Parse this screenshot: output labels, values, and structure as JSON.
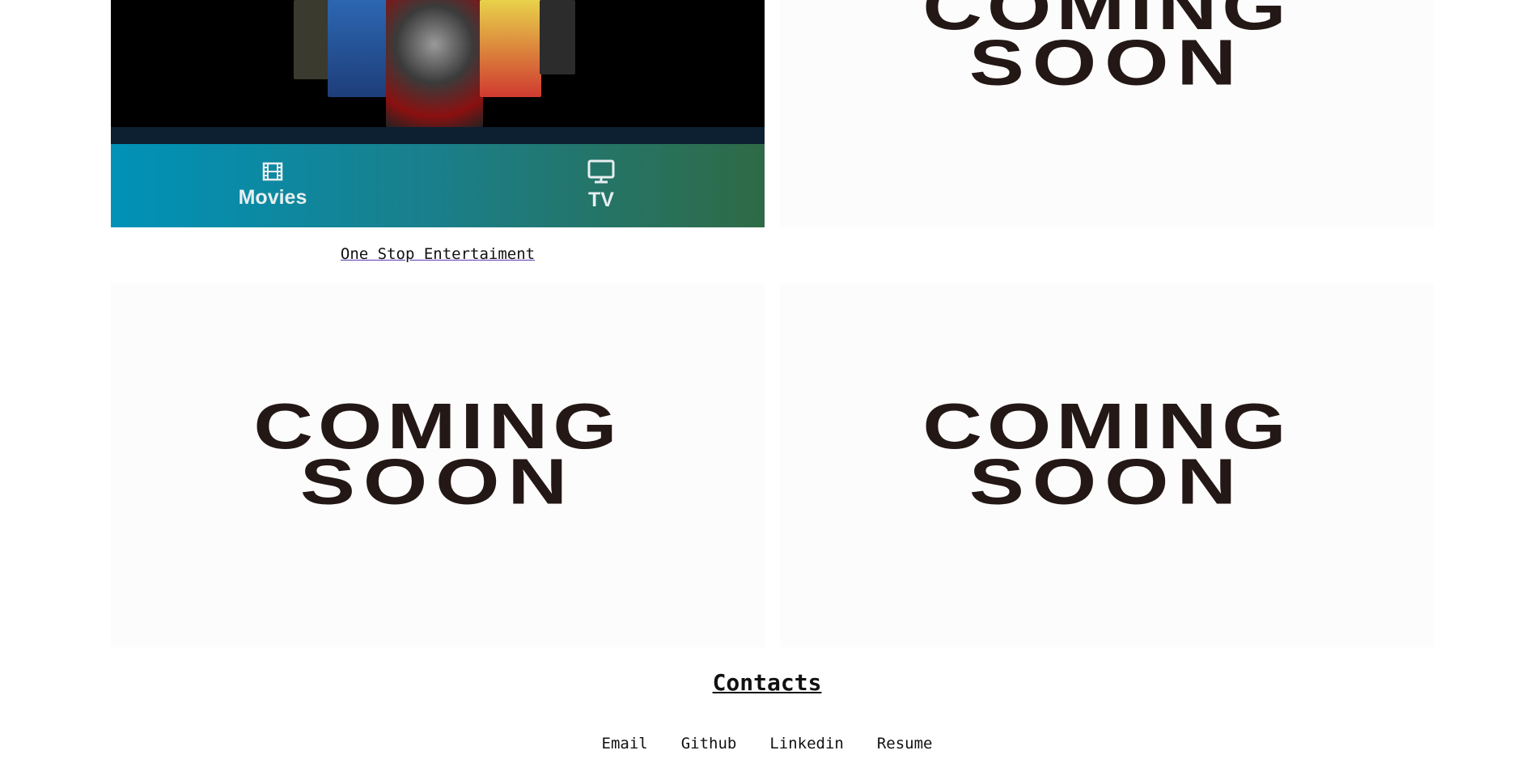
{
  "projects": [
    {
      "name": "One Stop Entertaiment",
      "nav": {
        "movies_label": "Movies",
        "tv_label": "TV"
      },
      "colors": {
        "gradient_start": "#0092b8",
        "gradient_end": "#2f6a45"
      }
    }
  ],
  "coming_soon": {
    "line1": "COMING",
    "line2": "SOON"
  },
  "contacts": {
    "title": "Contacts",
    "links": [
      "Email",
      "Github",
      "Linkedin",
      "Resume"
    ]
  }
}
